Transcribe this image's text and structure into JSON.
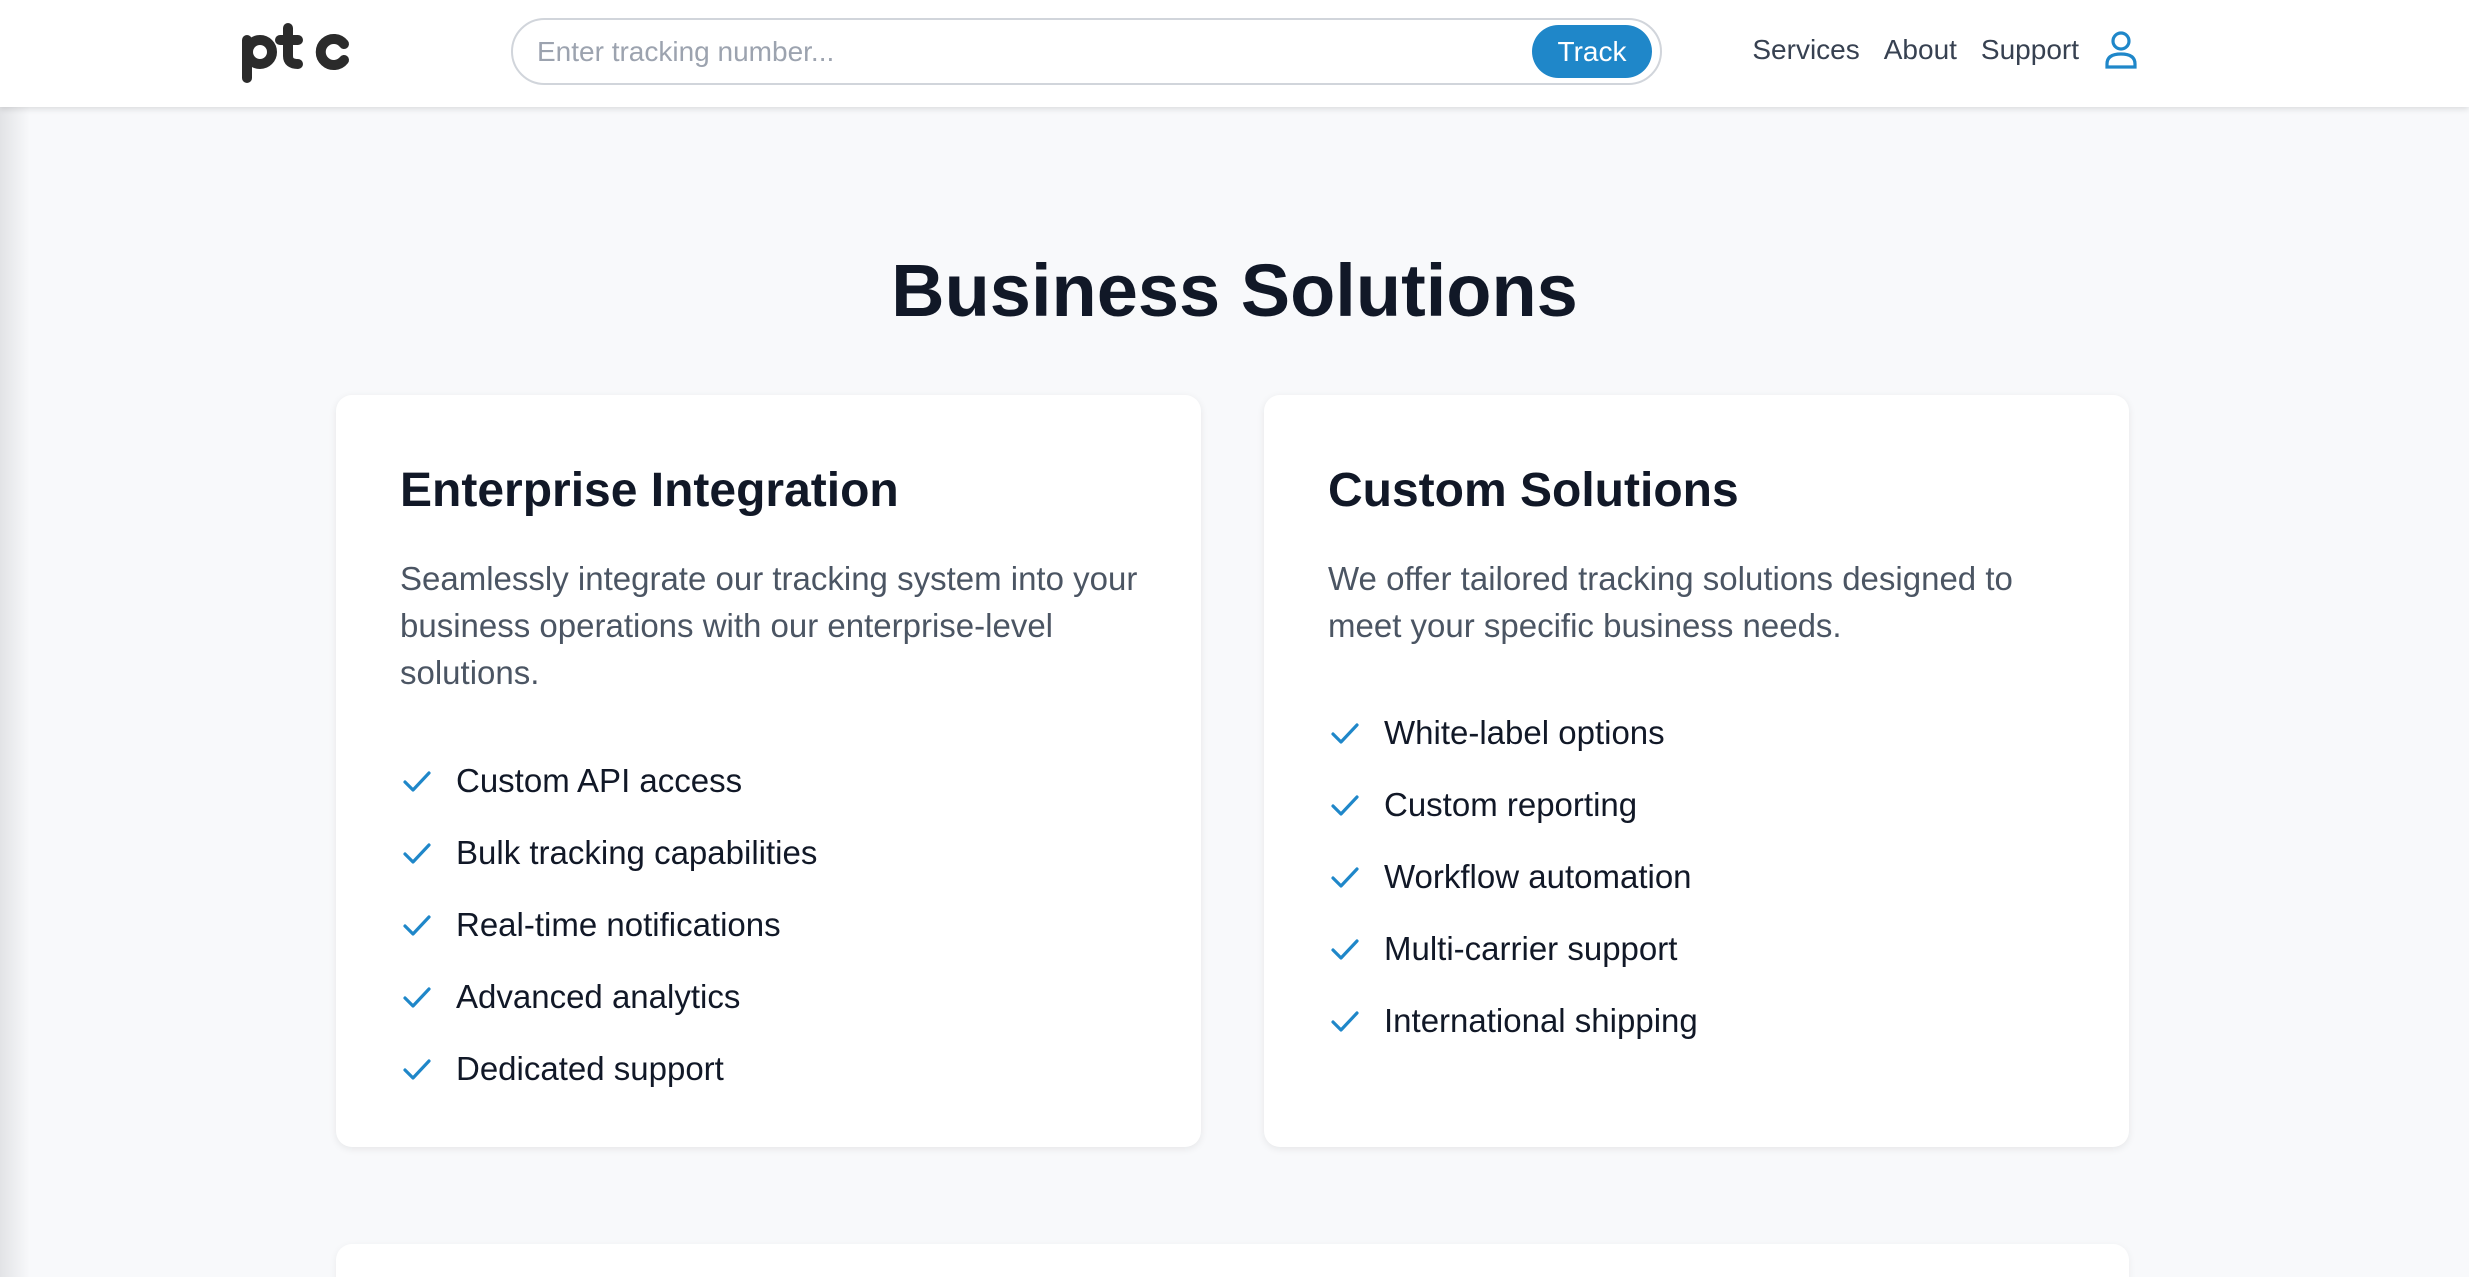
{
  "header": {
    "logo_text": "ptc",
    "search": {
      "placeholder": "Enter tracking number...",
      "value": "",
      "button_label": "Track"
    },
    "nav": [
      {
        "label": "Services"
      },
      {
        "label": "About"
      },
      {
        "label": "Support"
      }
    ],
    "account_icon": "user-icon"
  },
  "main": {
    "title": "Business Solutions",
    "cards": [
      {
        "title": "Enterprise Integration",
        "description": "Seamlessly integrate our tracking system into your business operations with our enterprise-level solutions.",
        "features": [
          "Custom API access",
          "Bulk tracking capabilities",
          "Real-time notifications",
          "Advanced analytics",
          "Dedicated support"
        ]
      },
      {
        "title": "Custom Solutions",
        "description": "We offer tailored tracking solutions designed to meet your specific business needs.",
        "features": [
          "White-label options",
          "Custom reporting",
          "Workflow automation",
          "Multi-carrier support",
          "International shipping"
        ]
      }
    ]
  },
  "colors": {
    "accent": "#1f87c9",
    "heading": "#111827",
    "body_text": "#4b5563",
    "page_background": "#f8f9fb"
  },
  "icons": {
    "feature_bullet": "check-icon",
    "account": "user-icon",
    "logo": "ptc-logo"
  }
}
